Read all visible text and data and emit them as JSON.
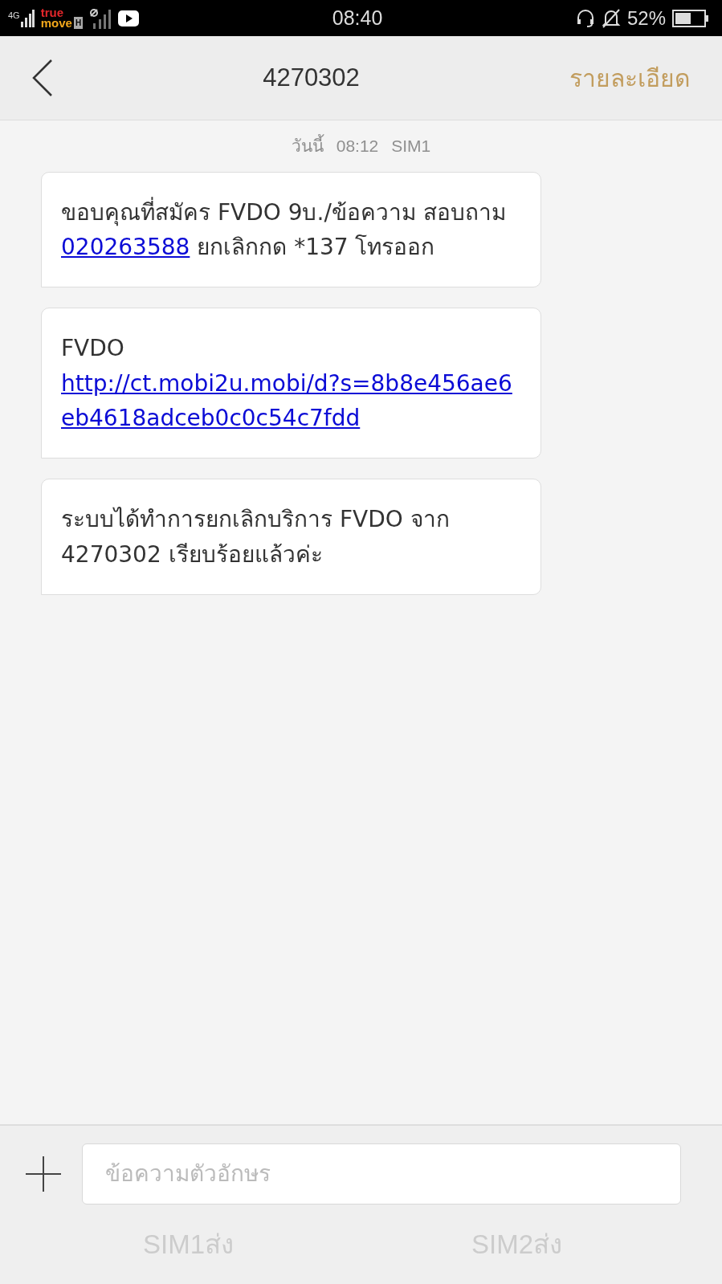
{
  "status_bar": {
    "network": "4G",
    "carrier": [
      "true",
      "move"
    ],
    "carrier_badge": "H",
    "time": "08:40",
    "battery": "52%"
  },
  "header": {
    "title": "4270302",
    "action": "รายละเอียด"
  },
  "timestamp": {
    "day": "วันนี้",
    "time": "08:12",
    "sim": "SIM1"
  },
  "messages": [
    {
      "parts": [
        {
          "kind": "text",
          "text": "ขอบคุณที่สมัคร FVDO 9บ./ข้อความ สอบถาม "
        },
        {
          "kind": "link",
          "text": "020263588"
        },
        {
          "kind": "text",
          "text": " ยกเลิกกด *137 โทรออก"
        }
      ]
    },
    {
      "parts": [
        {
          "kind": "text",
          "text": "FVDO "
        },
        {
          "kind": "link",
          "text": "http://ct.mobi2u.mobi/d?s=8b8e456ae6eb4618adceb0c0c54c7fdd"
        }
      ]
    },
    {
      "parts": [
        {
          "kind": "text",
          "text": "ระบบได้ทำการยกเลิกบริการ FVDO จาก 4270302 เรียบร้อยแล้วค่ะ"
        }
      ]
    }
  ],
  "composer": {
    "placeholder": "ข้อความตัวอักษร"
  },
  "send_buttons": [
    "SIM1ส่ง",
    "SIM2ส่ง"
  ]
}
